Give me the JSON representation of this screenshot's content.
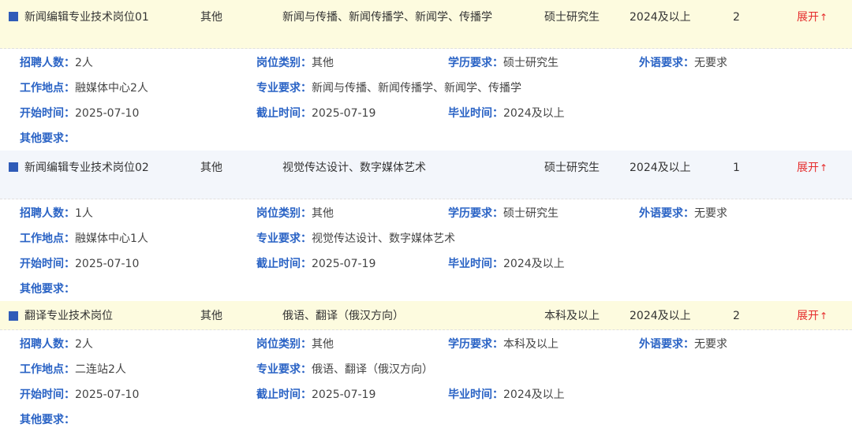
{
  "labels": {
    "count": "招聘人数：",
    "category": "岗位类别：",
    "education": "学历要求：",
    "language": "外语要求：",
    "location": "工作地点：",
    "major": "专业要求：",
    "start": "开始时间：",
    "end": "截止时间：",
    "grad": "毕业时间：",
    "other": "其他要求："
  },
  "toggle_label": "展开",
  "toggle_arrow": "↑",
  "jobs": [
    {
      "name": "新闻编辑专业技术岗位01",
      "type": "其他",
      "major": "新闻与传播、新闻传播学、新闻学、传播学",
      "education": "硕士研究生",
      "grad": "2024及以上",
      "count": "2",
      "detail": {
        "count": "2人",
        "category": "其他",
        "education": "硕士研究生",
        "language": "无要求",
        "location": "融媒体中心2人",
        "major": "新闻与传播、新闻传播学、新闻学、传播学",
        "start": "2025-07-10",
        "end": "2025-07-19",
        "grad": "2024及以上",
        "other": ""
      }
    },
    {
      "name": "新闻编辑专业技术岗位02",
      "type": "其他",
      "major": "视觉传达设计、数字媒体艺术",
      "education": "硕士研究生",
      "grad": "2024及以上",
      "count": "1",
      "detail": {
        "count": "1人",
        "category": "其他",
        "education": "硕士研究生",
        "language": "无要求",
        "location": "融媒体中心1人",
        "major": "视觉传达设计、数字媒体艺术",
        "start": "2025-07-10",
        "end": "2025-07-19",
        "grad": "2024及以上",
        "other": ""
      }
    },
    {
      "name": "翻译专业技术岗位",
      "type": "其他",
      "major": "俄语、翻译（俄汉方向）",
      "education": "本科及以上",
      "grad": "2024及以上",
      "count": "2",
      "detail": {
        "count": "2人",
        "category": "其他",
        "education": "本科及以上",
        "language": "无要求",
        "location": "二连站2人",
        "major": "俄语、翻译（俄汉方向）",
        "start": "2025-07-10",
        "end": "2025-07-19",
        "grad": "2024及以上",
        "other": ""
      }
    }
  ]
}
